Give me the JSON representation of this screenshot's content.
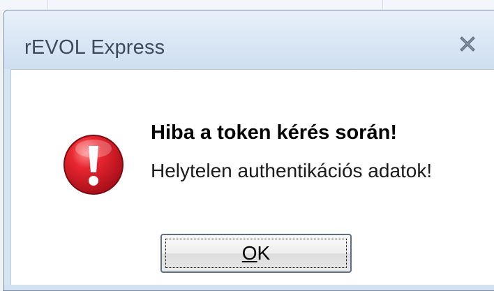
{
  "window": {
    "title": "rEVOL Express",
    "close_icon": "close-icon"
  },
  "dialog": {
    "icon": "error-icon",
    "heading": "Hiba a token kérés során!",
    "message": "Helytelen authentikációs adatok!",
    "ok_button": {
      "mnemonic": "O",
      "rest": "K"
    }
  },
  "colors": {
    "titlebar": "#d9e6f4",
    "client_bg": "#ffffff",
    "error_red": "#c8102e",
    "text": "#000000"
  }
}
